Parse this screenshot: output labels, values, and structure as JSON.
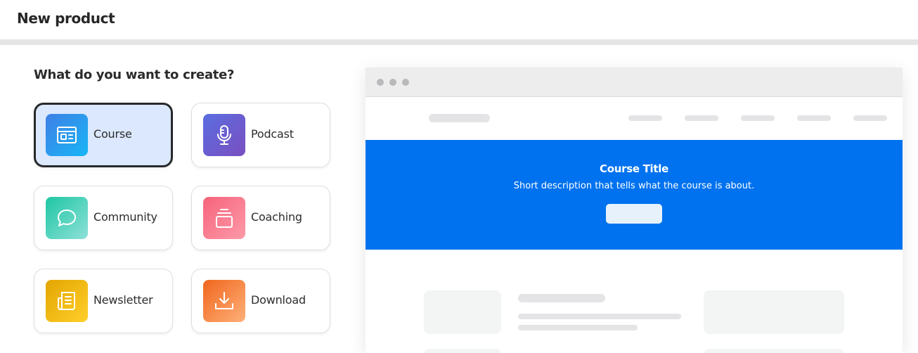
{
  "header": {
    "title": "New product"
  },
  "chooser": {
    "prompt": "What do you want to create?",
    "selected": "Course",
    "options": [
      {
        "label": "Course",
        "icon": "course-browser-icon",
        "gradient": [
          "#3f7fe6",
          "#18b6f6"
        ]
      },
      {
        "label": "Podcast",
        "icon": "microphone-icon",
        "gradient": [
          "#5a6ee0",
          "#7a4fc0"
        ]
      },
      {
        "label": "Community",
        "icon": "chat-bubble-icon",
        "gradient": [
          "#1dc7a4",
          "#8fe0d8"
        ]
      },
      {
        "label": "Coaching",
        "icon": "layers-icon",
        "gradient": [
          "#f6637c",
          "#fd9aa8"
        ]
      },
      {
        "label": "Newsletter",
        "icon": "newspaper-icon",
        "gradient": [
          "#e3a500",
          "#ffcf2b"
        ]
      },
      {
        "label": "Download",
        "icon": "download-icon",
        "gradient": [
          "#f0661c",
          "#ffb07a"
        ]
      }
    ]
  },
  "preview": {
    "hero": {
      "title": "Course Title",
      "description": "Short description that tells what the course is about."
    },
    "colors": {
      "hero_background": "#0072ef",
      "browser_bar": "#ededee",
      "selected_card": "#dbe8fd"
    }
  }
}
